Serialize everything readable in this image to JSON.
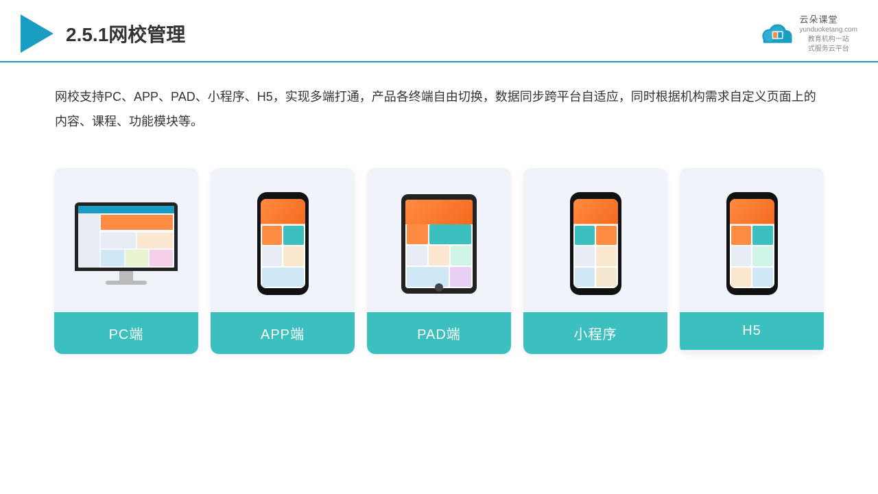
{
  "header": {
    "title": "2.5.1网校管理",
    "brand": {
      "name": "云朵课堂",
      "domain": "yunduoketang.com",
      "tagline": "教育机构一站\n式服务云平台"
    }
  },
  "description": "网校支持PC、APP、PAD、小程序、H5，实现多端打通，产品各终端自由切换，数据同步跨平台自适应，同时根据机构需求自定义页面上的内容、课程、功能模块等。",
  "cards": [
    {
      "id": "pc",
      "label": "PC端",
      "type": "pc"
    },
    {
      "id": "app",
      "label": "APP端",
      "type": "phone"
    },
    {
      "id": "pad",
      "label": "PAD端",
      "type": "tablet"
    },
    {
      "id": "miniapp",
      "label": "小程序",
      "type": "phone"
    },
    {
      "id": "h5",
      "label": "H5",
      "type": "phone"
    }
  ],
  "colors": {
    "accent": "#1a9dc3",
    "teal": "#3cbfbf",
    "cardBg": "#f0f4fa"
  }
}
